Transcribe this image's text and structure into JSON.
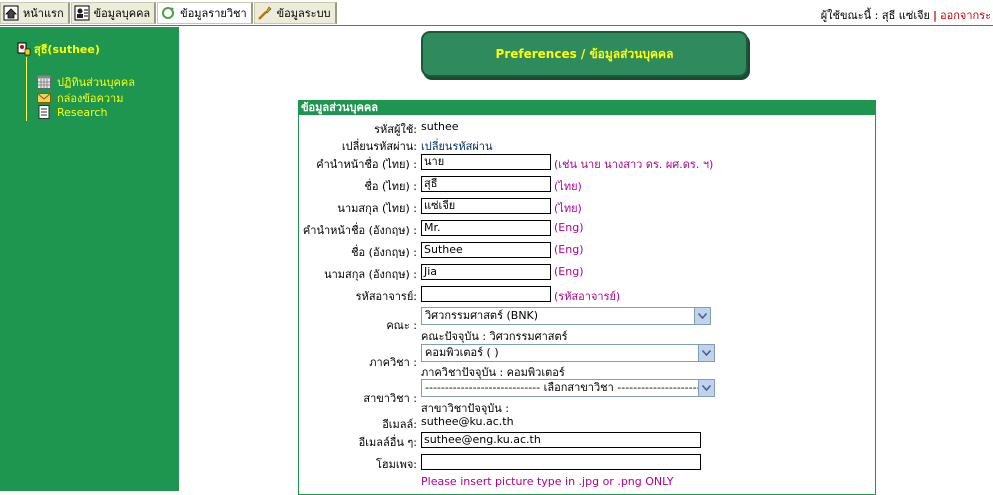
{
  "tabs": [
    {
      "label": "หน้าแรก",
      "icon": "home-icon"
    },
    {
      "label": "ข้อมูลบุคคล",
      "icon": "person-card-icon"
    },
    {
      "label": "ข้อมูลรายวิชา",
      "icon": "course-icon"
    },
    {
      "label": "ข้อมูลระบบ",
      "icon": "tools-icon"
    }
  ],
  "user_info": {
    "prefix": "ผู้ใช้ขณะนี้ : สุธี แซ่เจีย",
    "separator": "|",
    "logout": "ออกจากระ"
  },
  "sidebar": {
    "user": "สุธี(suthee)",
    "items": [
      {
        "label": "ปฏิทินส่วนบุคคล",
        "icon": "calendar-icon"
      },
      {
        "label": "กล่องข้อความ",
        "icon": "mail-icon"
      },
      {
        "label": "Research",
        "icon": "document-icon"
      }
    ]
  },
  "header": {
    "title": "Preferences / ข้อมูลส่วนบุคคล"
  },
  "form": {
    "section_title": "ข้อมูลส่วนบุคคล",
    "username_label": "รหัสผู้ใช้:",
    "username_value": "suthee",
    "password_label": "เปลี่ยนรหัสผ่าน:",
    "password_link": "เปลี่ยนรหัสผ่าน",
    "title_th_label": "คำนำหน้าชื่อ (ไทย) :",
    "title_th_value": "นาย",
    "title_th_hint": "(เช่น นาย นางสาว ดร. ผศ.ดร. ฯ)",
    "first_th_label": "ชื่อ (ไทย) :",
    "first_th_value": "สุธี",
    "first_th_hint": "(ไทย)",
    "last_th_label": "นามสกุล (ไทย) :",
    "last_th_value": "แซ่เจีย",
    "last_th_hint": "(ไทย)",
    "title_en_label": "คำนำหน้าชื่อ (อังกฤษ) :",
    "title_en_value": "Mr.",
    "title_en_hint": "(Eng)",
    "first_en_label": "ชื่อ (อังกฤษ) :",
    "first_en_value": "Suthee",
    "first_en_hint": "(Eng)",
    "last_en_label": "นามสกุล (อังกฤษ) :",
    "last_en_value": "Jia",
    "last_en_hint": "(Eng)",
    "teacher_code_label": "รหัสอาจารย์:",
    "teacher_code_value": "",
    "teacher_code_hint": "(รหัสอาจารย์)",
    "faculty_label": "คณะ :",
    "faculty_value": "วิศวกรรมศาสตร์ (BNK)",
    "faculty_current": "คณะปัจจุบัน : วิศวกรรมศาสตร์",
    "department_label": "ภาควิชา :",
    "department_value": "คอมพิวเตอร์ ( )",
    "department_current": "ภาควิชาปัจจุบัน : คอมพิวเตอร์",
    "major_label": "สาขาวิชา :",
    "major_value": "----------------------------- เลือกสาขาวิชา -----------------------------",
    "major_current": "สาขาวิชาปัจจุบัน :",
    "email_label": "อีเมลล์:",
    "email_value": "suthee@ku.ac.th",
    "other_email_label": "อีเมลล์อื่น ๆ:",
    "other_email_value": "suthee@eng.ku.ac.th",
    "homepage_label": "โฮมเพจ:",
    "homepage_value": "",
    "picture_note": "Please insert picture type in .jpg or .png ONLY"
  },
  "colors": {
    "sidebar_bg": "#1e9650",
    "accent_yellow": "#ffff00",
    "hint_magenta": "#b0008c",
    "logout_red": "#cc0000"
  }
}
